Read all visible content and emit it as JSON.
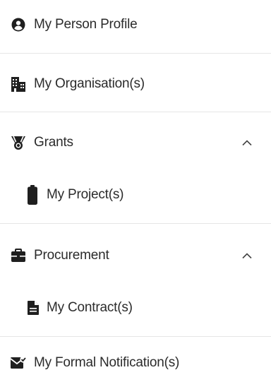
{
  "menu": {
    "items": [
      {
        "label": "My Person Profile",
        "icon": "person-circle-icon"
      },
      {
        "label": "My Organisation(s)",
        "icon": "building-icon"
      },
      {
        "label": "Grants",
        "icon": "grant-ribbon-icon",
        "expanded": true,
        "expand_icon": "chevron-up-icon"
      },
      {
        "label": "My Project(s)",
        "icon": "battery-icon"
      },
      {
        "label": "Procurement",
        "icon": "briefcase-icon",
        "expanded": true,
        "expand_icon": "chevron-up-icon"
      },
      {
        "label": "My Contract(s)",
        "icon": "document-icon"
      },
      {
        "label": "My Formal Notification(s)",
        "icon": "mail-check-icon"
      }
    ]
  },
  "colors": {
    "text": "#2b2b2b",
    "icon": "#1f1f1f",
    "divider": "#e6e6e6",
    "background": "#ffffff"
  }
}
